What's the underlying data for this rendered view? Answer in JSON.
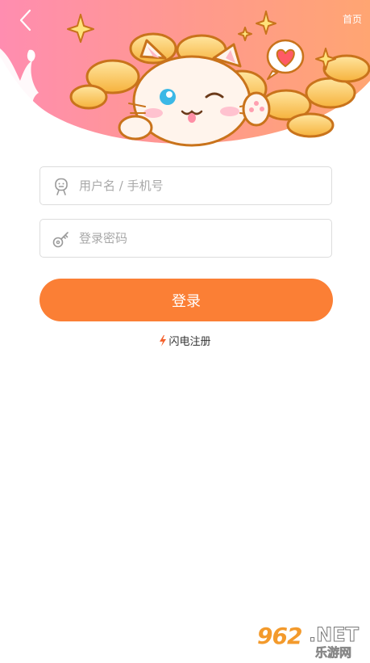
{
  "header": {
    "home_label": "首页"
  },
  "form": {
    "username_placeholder": "用户名 / 手机号",
    "username_value": "",
    "password_placeholder": "登录密码",
    "password_value": ""
  },
  "actions": {
    "login_label": "登录",
    "register_label": "闪电注册"
  },
  "watermark": {
    "number": "962",
    "tld": ".NET",
    "site_name": "乐游网"
  },
  "colors": {
    "accent": "#fb7f35",
    "header_gradient_start": "#ff8aa8",
    "header_gradient_end": "#ffa86e"
  },
  "icons": [
    "back-arrow-icon",
    "user-face-icon",
    "key-icon",
    "lightning-icon",
    "heart-icon",
    "sparkle-icon",
    "cat-mascot"
  ]
}
